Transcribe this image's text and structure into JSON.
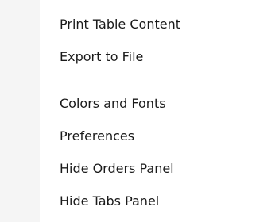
{
  "menu": {
    "items": [
      {
        "label": "Print Table Content"
      },
      {
        "label": "Export to File"
      },
      {
        "label": "Colors and Fonts"
      },
      {
        "label": "Preferences"
      },
      {
        "label": "Hide Orders Panel"
      },
      {
        "label": "Hide Tabs Panel"
      }
    ]
  },
  "colors": {
    "background": "#ffffff",
    "icon_strip": "#f5f5f5",
    "separator": "#c8c8c8",
    "text": "#1a1a1a"
  }
}
